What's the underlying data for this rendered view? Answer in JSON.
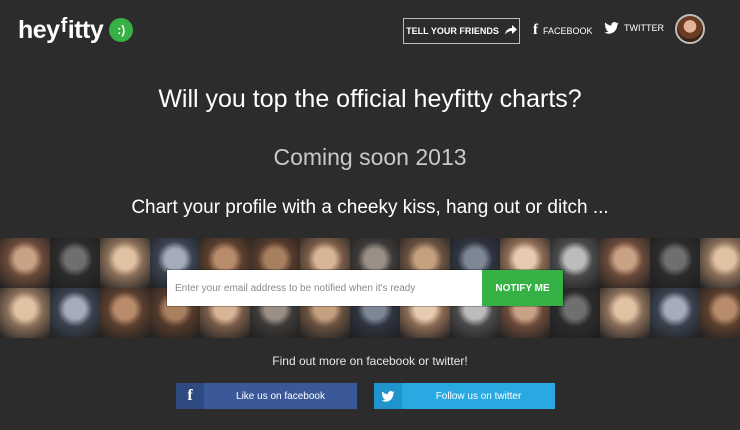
{
  "header": {
    "logo": {
      "text_before": "hey",
      "text_f": "f",
      "text_after": "itty",
      "bubble": ":)"
    },
    "tell_button": "TELL YOUR FRIENDS",
    "facebook_label": "FACEBOOK",
    "twitter_label": "TWITTER"
  },
  "hero": {
    "headline": "Will you top the official heyfitty charts?",
    "coming_soon": "Coming soon 2013",
    "tagline": "Chart your profile with a cheeky kiss, hang out or ditch ..."
  },
  "signup": {
    "placeholder": "Enter your email address to be notified when it's ready",
    "button": "NOTIFY ME"
  },
  "footer": {
    "find_out": "Find out more on facebook or twitter!",
    "facebook_button": "Like us on facebook",
    "twitter_button": "Follow us on twitter"
  },
  "colors": {
    "background": "#2c2c2c",
    "accent_green": "#35b145",
    "facebook_blue": "#3b5998",
    "twitter_blue": "#28a9e1"
  },
  "icons": {
    "share_arrow": "share-arrow-icon",
    "facebook": "facebook-icon",
    "twitter": "twitter-bird-icon"
  }
}
